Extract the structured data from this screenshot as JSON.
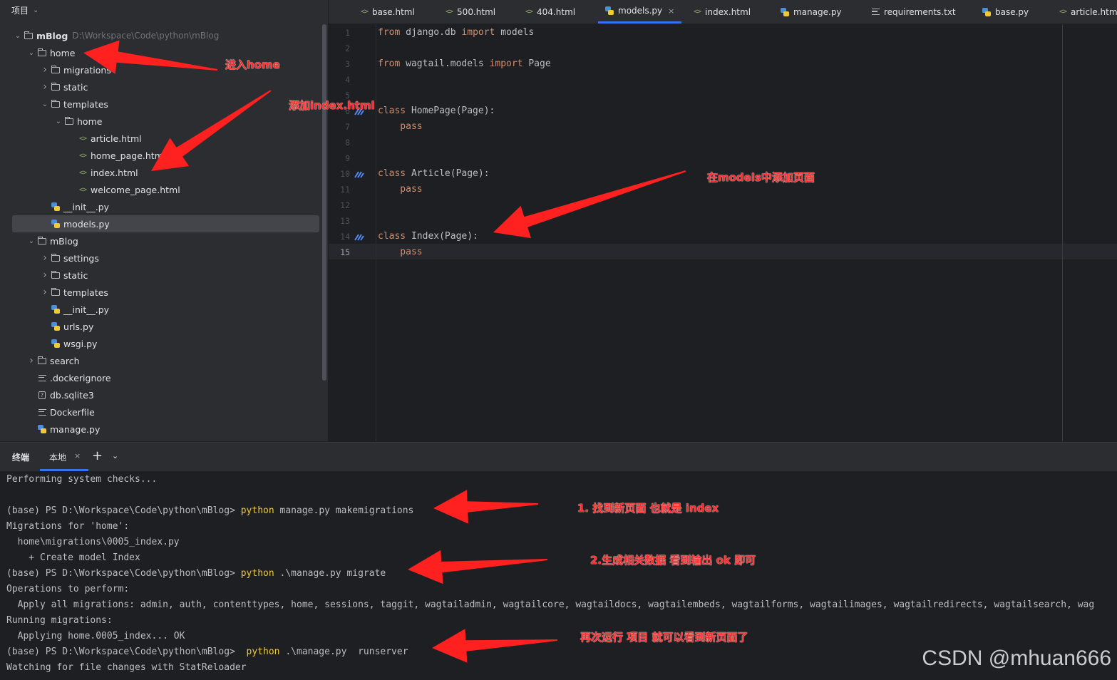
{
  "project_panel": {
    "title": "项目",
    "tree": [
      {
        "depth": 0,
        "expanded": true,
        "icon": "folder-icon",
        "label": "mBlog",
        "hint": "D:\\Workspace\\Code\\python\\mBlog",
        "bold": true
      },
      {
        "depth": 1,
        "expanded": true,
        "icon": "package-folder-icon",
        "label": "home"
      },
      {
        "depth": 2,
        "expanded": false,
        "icon": "package-folder-icon",
        "label": "migrations"
      },
      {
        "depth": 2,
        "expanded": false,
        "icon": "folder-icon",
        "label": "static"
      },
      {
        "depth": 2,
        "expanded": true,
        "icon": "folder-icon",
        "label": "templates"
      },
      {
        "depth": 3,
        "expanded": true,
        "icon": "folder-icon",
        "label": "home"
      },
      {
        "depth": 4,
        "icon": "html-file-icon",
        "label": "article.html"
      },
      {
        "depth": 4,
        "icon": "html-file-icon",
        "label": "home_page.htm"
      },
      {
        "depth": 4,
        "icon": "html-file-icon",
        "label": "index.html"
      },
      {
        "depth": 4,
        "icon": "html-file-icon",
        "label": "welcome_page.html"
      },
      {
        "depth": 2,
        "icon": "python-file-icon",
        "label": "__init__.py"
      },
      {
        "depth": 2,
        "icon": "python-file-icon",
        "label": "models.py",
        "selected": true
      },
      {
        "depth": 1,
        "expanded": true,
        "icon": "package-folder-icon",
        "label": "mBlog"
      },
      {
        "depth": 2,
        "expanded": false,
        "icon": "package-folder-icon",
        "label": "settings"
      },
      {
        "depth": 2,
        "expanded": false,
        "icon": "folder-icon",
        "label": "static"
      },
      {
        "depth": 2,
        "expanded": false,
        "icon": "folder-icon",
        "label": "templates"
      },
      {
        "depth": 2,
        "icon": "python-file-icon",
        "label": "__init__.py"
      },
      {
        "depth": 2,
        "icon": "python-file-icon",
        "label": "urls.py"
      },
      {
        "depth": 2,
        "icon": "python-file-icon",
        "label": "wsgi.py"
      },
      {
        "depth": 1,
        "expanded": false,
        "icon": "package-folder-icon",
        "label": "search"
      },
      {
        "depth": 1,
        "icon": "text-file-icon",
        "label": ".dockerignore"
      },
      {
        "depth": 1,
        "icon": "database-file-icon",
        "label": "db.sqlite3"
      },
      {
        "depth": 1,
        "icon": "text-file-icon",
        "label": "Dockerfile"
      },
      {
        "depth": 1,
        "icon": "python-file-icon",
        "label": "manage.py"
      }
    ]
  },
  "tabs": [
    {
      "label": "base.html",
      "icon": "html-file-icon"
    },
    {
      "label": "500.html",
      "icon": "html-file-icon"
    },
    {
      "label": "404.html",
      "icon": "html-file-icon"
    },
    {
      "label": "models.py",
      "icon": "python-file-icon",
      "active": true
    },
    {
      "label": "index.html",
      "icon": "html-file-icon"
    },
    {
      "label": "manage.py",
      "icon": "python-file-icon"
    },
    {
      "label": "requirements.txt",
      "icon": "text-file-icon"
    },
    {
      "label": "base.py",
      "icon": "python-file-icon"
    },
    {
      "label": "article.htm",
      "icon": "html-file-icon"
    }
  ],
  "editor": {
    "current_line": 15,
    "lines": [
      {
        "n": "1",
        "segments": [
          {
            "t": "from ",
            "k": true
          },
          {
            "t": "django.db "
          },
          {
            "t": "import ",
            "k": true
          },
          {
            "t": "models"
          }
        ]
      },
      {
        "n": "2",
        "segments": []
      },
      {
        "n": "3",
        "segments": [
          {
            "t": "from ",
            "k": true
          },
          {
            "t": "wagtail.models "
          },
          {
            "t": "import ",
            "k": true
          },
          {
            "t": "Page"
          }
        ]
      },
      {
        "n": "4",
        "segments": []
      },
      {
        "n": "5",
        "segments": []
      },
      {
        "n": "6",
        "mark": true,
        "segments": [
          {
            "t": "class ",
            "k": true
          },
          {
            "t": "HomePage(Page):"
          }
        ]
      },
      {
        "n": "7",
        "segments": [
          {
            "t": "    pass",
            "k": true
          }
        ]
      },
      {
        "n": "8",
        "segments": []
      },
      {
        "n": "9",
        "segments": []
      },
      {
        "n": "10",
        "mark": true,
        "segments": [
          {
            "t": "class ",
            "k": true
          },
          {
            "t": "Article(Page):"
          }
        ]
      },
      {
        "n": "11",
        "segments": [
          {
            "t": "    pass",
            "k": true
          }
        ]
      },
      {
        "n": "12",
        "segments": []
      },
      {
        "n": "13",
        "segments": []
      },
      {
        "n": "14",
        "mark": true,
        "segments": [
          {
            "t": "class ",
            "k": true
          },
          {
            "t": "Index(Page):"
          }
        ]
      },
      {
        "n": "15",
        "segments": [
          {
            "t": "    pass",
            "k": true
          }
        ]
      }
    ]
  },
  "terminal": {
    "title": "终端",
    "tab_label": "本地",
    "close_symbol": "×",
    "add_symbol": "+",
    "dropdown_symbol": "⌄",
    "lines": [
      [
        {
          "t": "Performing system checks..."
        }
      ],
      [],
      [
        {
          "t": "(base) PS D:\\Workspace\\Code\\python\\mBlog> "
        },
        {
          "t": "python",
          "c": true
        },
        {
          "t": " manage.py makemigrations"
        }
      ],
      [
        {
          "t": "Migrations for 'home':"
        }
      ],
      [
        {
          "t": "  home\\migrations\\0005_index.py"
        }
      ],
      [
        {
          "t": "    + Create model Index"
        }
      ],
      [
        {
          "t": "(base) PS D:\\Workspace\\Code\\python\\mBlog> "
        },
        {
          "t": "python",
          "c": true
        },
        {
          "t": " .\\manage.py migrate"
        }
      ],
      [
        {
          "t": "Operations to perform:"
        }
      ],
      [
        {
          "t": "  Apply all migrations: admin, auth, contenttypes, home, sessions, taggit, wagtailadmin, wagtailcore, wagtaildocs, wagtailembeds, wagtailforms, wagtailimages, wagtailredirects, wagtailsearch, wag"
        }
      ],
      [
        {
          "t": "Running migrations:"
        }
      ],
      [
        {
          "t": "  Applying home.0005_index... OK"
        }
      ],
      [
        {
          "t": "(base) PS D:\\Workspace\\Code\\python\\mBlog>  "
        },
        {
          "t": "python",
          "c": true
        },
        {
          "t": " .\\manage.py  runserver"
        }
      ],
      [
        {
          "t": "Watching for file changes with StatReloader"
        }
      ]
    ]
  },
  "annotations": {
    "enter_home": "进入home",
    "add_index_html": "添加index.html",
    "add_page_in_models": "在models中添加页面",
    "step1": "1. 找到新页面  也就是 index",
    "step2": "2.生成相关数据   看到输出 ok 即可",
    "step3": "再次运行 项目  就可以看到新页面了",
    "arrow_color": "#ff2020"
  },
  "watermark": "CSDN @mhuan666",
  "colors": {
    "keyword": "#cf8e6d",
    "terminal_command": "#f0c93a",
    "accent": "#3574f0"
  }
}
